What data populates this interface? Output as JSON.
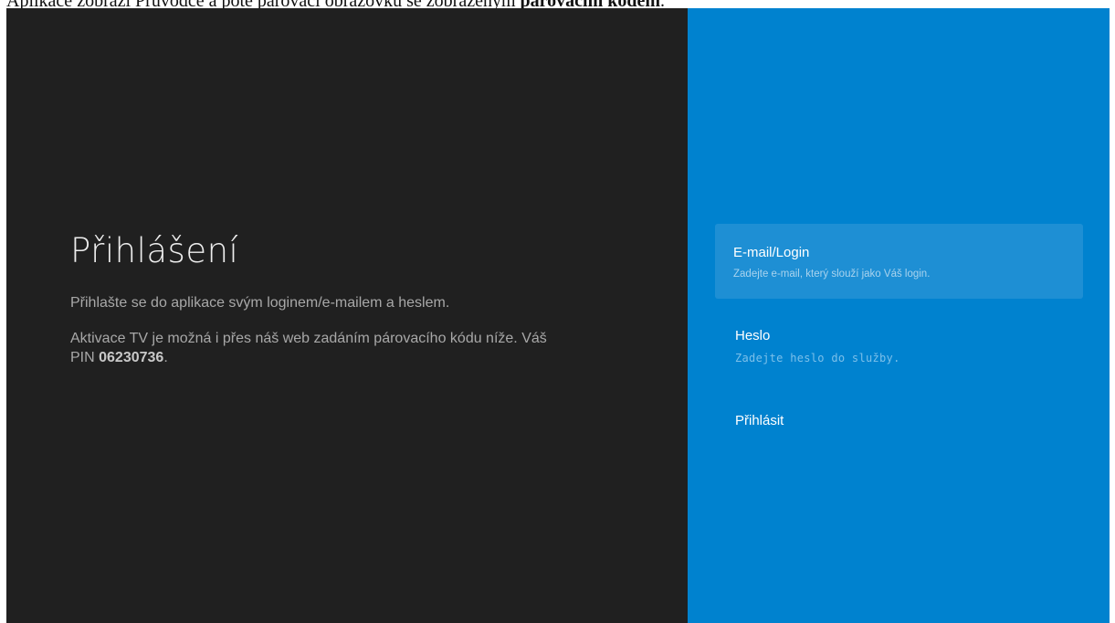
{
  "caption": {
    "text": "Aplikace zobrazí Průvodce a poté párovací obrazovku se zobrazeným ",
    "bold": "párovacím kódem",
    "suffix": "."
  },
  "login": {
    "title": "Přihlášení",
    "description_1": "Přihlašte se do aplikace svým loginem/e-mailem a heslem.",
    "description_2_prefix": "Aktivace TV je možná i přes náš web zadáním párovacího kódu níže. Váš PIN ",
    "pin": "06230736",
    "description_2_suffix": "."
  },
  "form": {
    "email_label": "E-mail/Login",
    "email_hint": "Zadejte e-mail, který slouží jako Váš login.",
    "password_label": "Heslo",
    "password_hint": "Zadejte heslo do služby.",
    "submit_label": "Přihlásit"
  },
  "colors": {
    "left_background": "#202020",
    "right_background": "#0082cf",
    "focused_field": "#1e8fd4"
  }
}
